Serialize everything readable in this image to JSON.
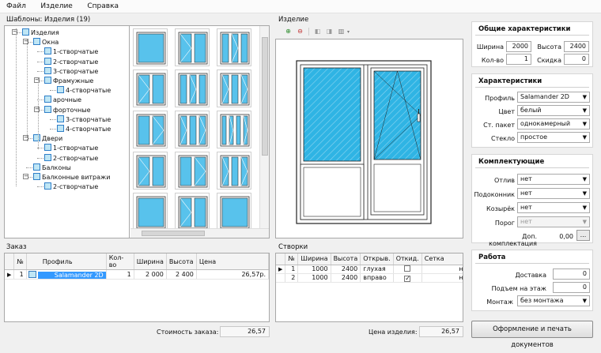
{
  "menu": {
    "items": [
      "Файл",
      "Изделие",
      "Справка"
    ]
  },
  "templates": {
    "title": "Шаблоны: Изделия (19)",
    "tree": [
      {
        "label": "Изделия",
        "level": 0
      },
      {
        "label": "Окна",
        "level": 1
      },
      {
        "label": "1-створчатые",
        "level": 2
      },
      {
        "label": "2-створчатые",
        "level": 2
      },
      {
        "label": "3-створчатые",
        "level": 2
      },
      {
        "label": "Фрамужные",
        "level": 2
      },
      {
        "label": "4-створчатые",
        "level": 3
      },
      {
        "label": "арочные",
        "level": 2
      },
      {
        "label": "форточные",
        "level": 2
      },
      {
        "label": "3-створчатые",
        "level": 3
      },
      {
        "label": "4-створчатые",
        "level": 3
      },
      {
        "label": "Двери",
        "level": 1
      },
      {
        "label": "1-створчатые",
        "level": 2
      },
      {
        "label": "2-створчатые",
        "level": 2
      },
      {
        "label": "Балконы",
        "level": 1
      },
      {
        "label": "Балконные витражи",
        "level": 1
      },
      {
        "label": "2-створчатые",
        "level": 2
      }
    ]
  },
  "product": {
    "title": "Изделие"
  },
  "order": {
    "title": "Заказ",
    "columns": [
      "№",
      "Профиль",
      "Кол-во",
      "Ширина",
      "Высота",
      "Цена"
    ],
    "rows": [
      {
        "num": "1",
        "profile": "Salamander 2D",
        "qty": "1",
        "width": "2 000",
        "height": "2 400",
        "price": "26,57р."
      }
    ],
    "total_label": "Стоимость заказа:",
    "total_value": "26,57"
  },
  "sashes": {
    "title": "Створки",
    "columns": [
      "№",
      "Ширина",
      "Высота",
      "Открыв.",
      "Откид.",
      "Сетка"
    ],
    "rows": [
      {
        "num": "1",
        "width": "1000",
        "height": "2400",
        "opening": "глухая",
        "tilt": false,
        "net": "нет"
      },
      {
        "num": "2",
        "width": "1000",
        "height": "2400",
        "opening": "вправо",
        "tilt": true,
        "net": "нет"
      }
    ],
    "price_label": "Цена изделия:",
    "price_value": "26,57"
  },
  "general": {
    "title": "Общие характеристики",
    "width_label": "Ширина",
    "width": "2000",
    "height_label": "Высота",
    "height": "2400",
    "qty_label": "Кол-во",
    "qty": "1",
    "discount_label": "Скидка",
    "discount": "0"
  },
  "characteristics": {
    "title": "Характеристики",
    "profile_label": "Профиль",
    "profile": "Salamander 2D",
    "color_label": "Цвет",
    "color": "белый",
    "glass_unit_label": "Ст. пакет",
    "glass_unit": "однокамерный",
    "glass_label": "Стекло",
    "glass": "простое"
  },
  "accessories": {
    "title": "Комплектующие",
    "drip_label": "Отлив",
    "drip": "нет",
    "sill_label": "Подоконник",
    "sill": "нет",
    "visor_label": "Козырёк",
    "visor": "нет",
    "threshold_label": "Порог",
    "threshold": "нет",
    "extra_label": "Доп. комплектация",
    "extra": "0,00",
    "extra_button": "..."
  },
  "work": {
    "title": "Работа",
    "delivery_label": "Доставка",
    "delivery": "0",
    "lift_label": "Подъем на этаж",
    "lift": "0",
    "install_label": "Монтаж",
    "install": "без монтажа"
  },
  "print_button": "Оформление и печать документов",
  "colors": {
    "glass": "#2fb4e4",
    "selection": "#3399ff",
    "frame": "#222222"
  }
}
